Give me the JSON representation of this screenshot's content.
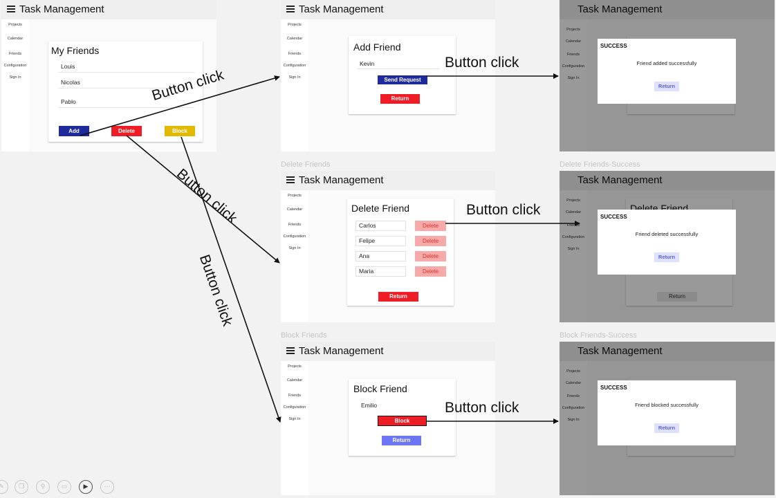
{
  "app_title": "Task Management",
  "nav": [
    "Projects",
    "Calendar",
    "Friends",
    "Configuration",
    "Sign In"
  ],
  "frame_labels": {
    "delete_friends": "Delete Friends",
    "delete_friends_success": "Delete Friends-Success",
    "block_friends": "Block Friends",
    "block_friends_success": "Block Friends-Success"
  },
  "my_friends": {
    "title": "My Friends",
    "friends": [
      "Louis",
      "Nicolas",
      "Pablo"
    ],
    "add": "Add",
    "delete": "Delete",
    "block": "Block"
  },
  "add_friend": {
    "title": "Add Friend",
    "input": "Kevin",
    "send": "Send Request",
    "return": "Return"
  },
  "delete_friend": {
    "title": "Delete Friend",
    "friends": [
      "Carlos",
      "Felipe",
      "Ana",
      "Maria"
    ],
    "delete": "Delete",
    "return": "Return"
  },
  "block_friend": {
    "title": "Block Friend",
    "name": "Emilio",
    "block": "Block",
    "return": "Return"
  },
  "success": {
    "header": "SUCCESS",
    "added": "Friend added successfully",
    "deleted": "Friend deleted successfully",
    "blocked": "Friend blocked successfully",
    "return": "Return"
  },
  "arrow_label": "Button click",
  "colors": {
    "add": "#1f2a9c",
    "delete": "#ee1c24",
    "block": "#e2b800",
    "delete_light": "#f7aaaa",
    "return_blue": "#6b75f5"
  }
}
